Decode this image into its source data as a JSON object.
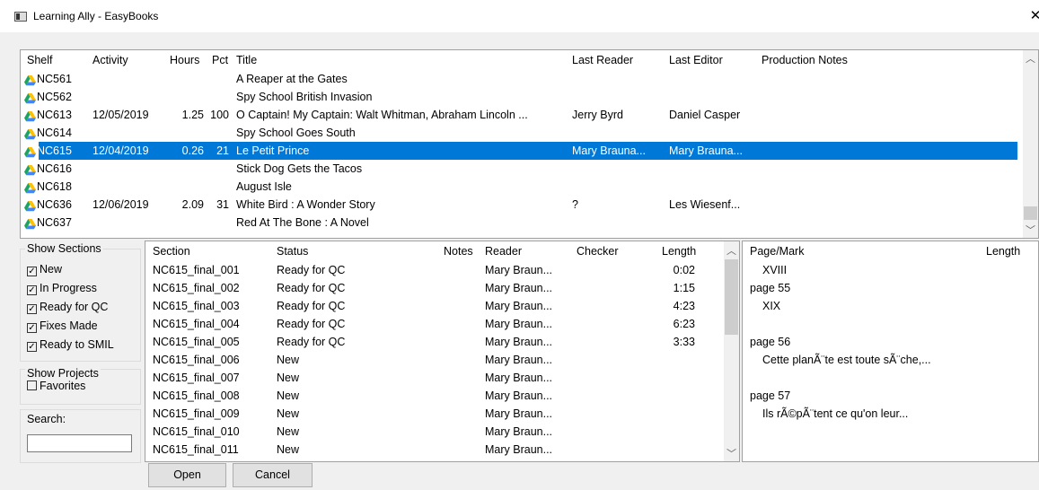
{
  "window": {
    "title": "Learning Ally - EasyBooks",
    "close": "✕"
  },
  "shelf_table": {
    "headers": {
      "shelf": "Shelf",
      "activity": "Activity",
      "hours": "Hours",
      "pct": "Pct",
      "title": "Title",
      "last_reader": "Last Reader",
      "last_editor": "Last Editor",
      "notes": "Production Notes"
    },
    "rows": [
      {
        "shelf": "NC561",
        "activity": "",
        "hours": "",
        "pct": "",
        "title": "A Reaper at the Gates",
        "last_reader": "",
        "last_editor": "",
        "selected": false
      },
      {
        "shelf": "NC562",
        "activity": "",
        "hours": "",
        "pct": "",
        "title": "Spy School British Invasion",
        "last_reader": "",
        "last_editor": "",
        "selected": false
      },
      {
        "shelf": "NC613",
        "activity": "12/05/2019",
        "hours": "1.25",
        "pct": "100",
        "title": "O Captain! My Captain: Walt Whitman, Abraham Lincoln ...",
        "last_reader": "Jerry Byrd",
        "last_editor": "Daniel Casper",
        "selected": false
      },
      {
        "shelf": "NC614",
        "activity": "",
        "hours": "",
        "pct": "",
        "title": "Spy School Goes South",
        "last_reader": "",
        "last_editor": "",
        "selected": false
      },
      {
        "shelf": "NC615",
        "activity": "12/04/2019",
        "hours": "0.26",
        "pct": "21",
        "title": "Le Petit Prince",
        "last_reader": "Mary Brauna...",
        "last_editor": "Mary Brauna...",
        "selected": true
      },
      {
        "shelf": "NC616",
        "activity": "",
        "hours": "",
        "pct": "",
        "title": "Stick Dog Gets the Tacos",
        "last_reader": "",
        "last_editor": "",
        "selected": false
      },
      {
        "shelf": "NC618",
        "activity": "",
        "hours": "",
        "pct": "",
        "title": "August Isle",
        "last_reader": "",
        "last_editor": "",
        "selected": false
      },
      {
        "shelf": "NC636",
        "activity": "12/06/2019",
        "hours": "2.09",
        "pct": "31",
        "title": "White Bird : A Wonder Story",
        "last_reader": "?",
        "last_editor": "Les Wiesenf...",
        "selected": false
      },
      {
        "shelf": "NC637",
        "activity": "",
        "hours": "",
        "pct": "",
        "title": "Red At The Bone : A Novel",
        "last_reader": "",
        "last_editor": "",
        "selected": false
      }
    ]
  },
  "show_sections": {
    "title": "Show Sections",
    "items": [
      {
        "label": "New",
        "checked": true
      },
      {
        "label": "In Progress",
        "checked": true
      },
      {
        "label": "Ready for QC",
        "checked": true
      },
      {
        "label": "Fixes Made",
        "checked": true
      },
      {
        "label": "Ready to SMIL",
        "checked": true
      }
    ]
  },
  "show_projects": {
    "title": "Show Projects",
    "favorites": {
      "label": "Favorites",
      "checked": false
    }
  },
  "search": {
    "label": "Search:",
    "value": ""
  },
  "sections_table": {
    "headers": {
      "section": "Section",
      "status": "Status",
      "notes": "Notes",
      "reader": "Reader",
      "checker": "Checker",
      "length": "Length"
    },
    "rows": [
      {
        "section": "NC615_final_001",
        "status": "Ready for QC",
        "reader": "Mary Braun...",
        "checker": "",
        "length": "0:02"
      },
      {
        "section": "NC615_final_002",
        "status": "Ready for QC",
        "reader": "Mary Braun...",
        "checker": "",
        "length": "1:15"
      },
      {
        "section": "NC615_final_003",
        "status": "Ready for QC",
        "reader": "Mary Braun...",
        "checker": "",
        "length": "4:23"
      },
      {
        "section": "NC615_final_004",
        "status": "Ready for QC",
        "reader": "Mary Braun...",
        "checker": "",
        "length": "6:23"
      },
      {
        "section": "NC615_final_005",
        "status": "Ready for QC",
        "reader": "Mary Braun...",
        "checker": "",
        "length": "3:33"
      },
      {
        "section": "NC615_final_006",
        "status": "New",
        "reader": "Mary Braun...",
        "checker": "",
        "length": ""
      },
      {
        "section": "NC615_final_007",
        "status": "New",
        "reader": "Mary Braun...",
        "checker": "",
        "length": ""
      },
      {
        "section": "NC615_final_008",
        "status": "New",
        "reader": "Mary Braun...",
        "checker": "",
        "length": ""
      },
      {
        "section": "NC615_final_009",
        "status": "New",
        "reader": "Mary Braun...",
        "checker": "",
        "length": ""
      },
      {
        "section": "NC615_final_010",
        "status": "New",
        "reader": "Mary Braun...",
        "checker": "",
        "length": ""
      },
      {
        "section": "NC615_final_011",
        "status": "New",
        "reader": "Mary Braun...",
        "checker": "",
        "length": ""
      }
    ]
  },
  "page_marks": {
    "headers": {
      "mark": "Page/Mark",
      "length": "Length"
    },
    "rows": [
      {
        "text": "XVIII",
        "indent": true
      },
      {
        "text": "page 55",
        "indent": false
      },
      {
        "text": "XIX",
        "indent": true
      },
      {
        "text": "",
        "indent": false
      },
      {
        "text": "page 56",
        "indent": false
      },
      {
        "text": "Cette planÃ¨te est toute sÃ¨che,...",
        "indent": true
      },
      {
        "text": "",
        "indent": false
      },
      {
        "text": "page 57",
        "indent": false
      },
      {
        "text": "Ils rÃ©pÃ¨tent ce qu'on leur...",
        "indent": true
      }
    ]
  },
  "buttons": {
    "open": "Open",
    "cancel": "Cancel"
  },
  "colors": {
    "selection": "#0078d7",
    "drive_green": "#1da462",
    "drive_yellow": "#ffc107",
    "drive_blue": "#4285f4"
  },
  "icons": {
    "shelf": "google-drive-icon",
    "scroll_up": "chevron-up-icon",
    "scroll_down": "chevron-down-icon",
    "checkbox": "checkbox-icon"
  }
}
